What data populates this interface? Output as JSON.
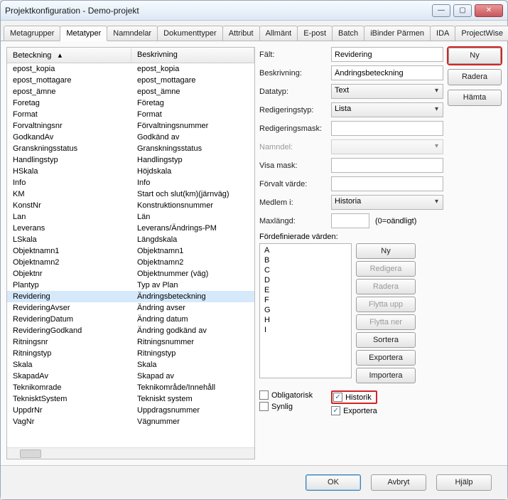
{
  "window": {
    "title": "Projektkonfiguration - Demo-projekt"
  },
  "tabs": {
    "items": [
      "Metagrupper",
      "Metatyper",
      "Namndelar",
      "Dokumenttyper",
      "Attribut",
      "Allmänt",
      "E-post",
      "Batch",
      "iBinder Pärmen",
      "IDA",
      "ProjectWise"
    ],
    "active_index": 1
  },
  "list": {
    "col1_header": "Beteckning",
    "col2_header": "Beskrivning",
    "sort_glyph": "▴",
    "rows": [
      {
        "b": "epost_kopia",
        "d": "epost_kopia"
      },
      {
        "b": "epost_mottagare",
        "d": "epost_mottagare"
      },
      {
        "b": "epost_ämne",
        "d": "epost_ämne"
      },
      {
        "b": "Foretag",
        "d": "Företag"
      },
      {
        "b": "Format",
        "d": "Format"
      },
      {
        "b": "Forvaltningsnr",
        "d": "Förvaltningsnummer"
      },
      {
        "b": "GodkandAv",
        "d": "Godkänd av"
      },
      {
        "b": "Granskningsstatus",
        "d": "Granskningsstatus"
      },
      {
        "b": "Handlingstyp",
        "d": "Handlingstyp"
      },
      {
        "b": "HSkala",
        "d": "Höjdskala"
      },
      {
        "b": "Info",
        "d": "Info"
      },
      {
        "b": "KM",
        "d": "Start och slut(km)(järnväg)"
      },
      {
        "b": "KonstNr",
        "d": "Konstruktionsnummer"
      },
      {
        "b": "Lan",
        "d": "Län"
      },
      {
        "b": "Leverans",
        "d": "Leverans/Ändrings-PM"
      },
      {
        "b": "LSkala",
        "d": "Längdskala"
      },
      {
        "b": "Objektnamn1",
        "d": "Objektnamn1"
      },
      {
        "b": "Objektnamn2",
        "d": "Objektnamn2"
      },
      {
        "b": "Objektnr",
        "d": "Objektnummer (väg)"
      },
      {
        "b": "Plantyp",
        "d": "Typ av Plan"
      },
      {
        "b": "Revidering",
        "d": "Ändringsbeteckning"
      },
      {
        "b": "RevideringAvser",
        "d": "Ändring avser"
      },
      {
        "b": "RevideringDatum",
        "d": "Ändring datum"
      },
      {
        "b": "RevideringGodkand",
        "d": "Ändring godkänd av"
      },
      {
        "b": "Ritningsnr",
        "d": "Ritningsnummer"
      },
      {
        "b": "Ritningstyp",
        "d": "Ritningstyp"
      },
      {
        "b": "Skala",
        "d": "Skala"
      },
      {
        "b": "SkapadAv",
        "d": "Skapad av"
      },
      {
        "b": "Teknikomrade",
        "d": "Teknikområde/Innehåll"
      },
      {
        "b": "TeknisktSystem",
        "d": "Tekniskt system"
      },
      {
        "b": "UppdrNr",
        "d": "Uppdragsnummer"
      },
      {
        "b": "VagNr",
        "d": "Vägnummer"
      }
    ],
    "selected_index": 20
  },
  "form": {
    "labels": {
      "falt": "Fält:",
      "beskrivning": "Beskrivning:",
      "datatyp": "Datatyp:",
      "redigeringstyp": "Redigeringstyp:",
      "redigeringsmask": "Redigeringsmask:",
      "namndel": "Namndel:",
      "visamask": "Visa mask:",
      "forvalt": "Förvalt värde:",
      "medlemi": "Medlem i:",
      "maxlangd": "Maxlängd:",
      "maxlangd_hint": "(0=oändligt)",
      "fordefinierade": "Fördefinierade värden:"
    },
    "values": {
      "falt": "Revidering",
      "beskrivning": "Ändringsbeteckning",
      "datatyp": "Text",
      "redigeringstyp": "Lista",
      "redigeringsmask": "",
      "namndel": "",
      "visamask": "",
      "forvalt": "",
      "medlemi": "Historia",
      "maxlangd": ""
    },
    "predef": [
      "",
      "A",
      "B",
      "C",
      "D",
      "E",
      "F",
      "G",
      "H",
      "I"
    ],
    "buttons": {
      "ny": "Ny",
      "radera": "Radera",
      "hamta": "Hämta"
    },
    "predef_buttons": {
      "ny": "Ny",
      "redigera": "Redigera",
      "radera": "Radera",
      "flyttaupp": "Flytta upp",
      "flyttaner": "Flytta ner",
      "sortera": "Sortera",
      "exportera": "Exportera",
      "importera": "Importera"
    },
    "checks": {
      "obligatorisk": {
        "label": "Obligatorisk",
        "checked": false
      },
      "synlig": {
        "label": "Synlig",
        "checked": false
      },
      "historik": {
        "label": "Historik",
        "checked": true
      },
      "exportera": {
        "label": "Exportera",
        "checked": true
      }
    }
  },
  "footer": {
    "ok": "OK",
    "avbryt": "Avbryt",
    "hjalp": "Hjälp"
  }
}
